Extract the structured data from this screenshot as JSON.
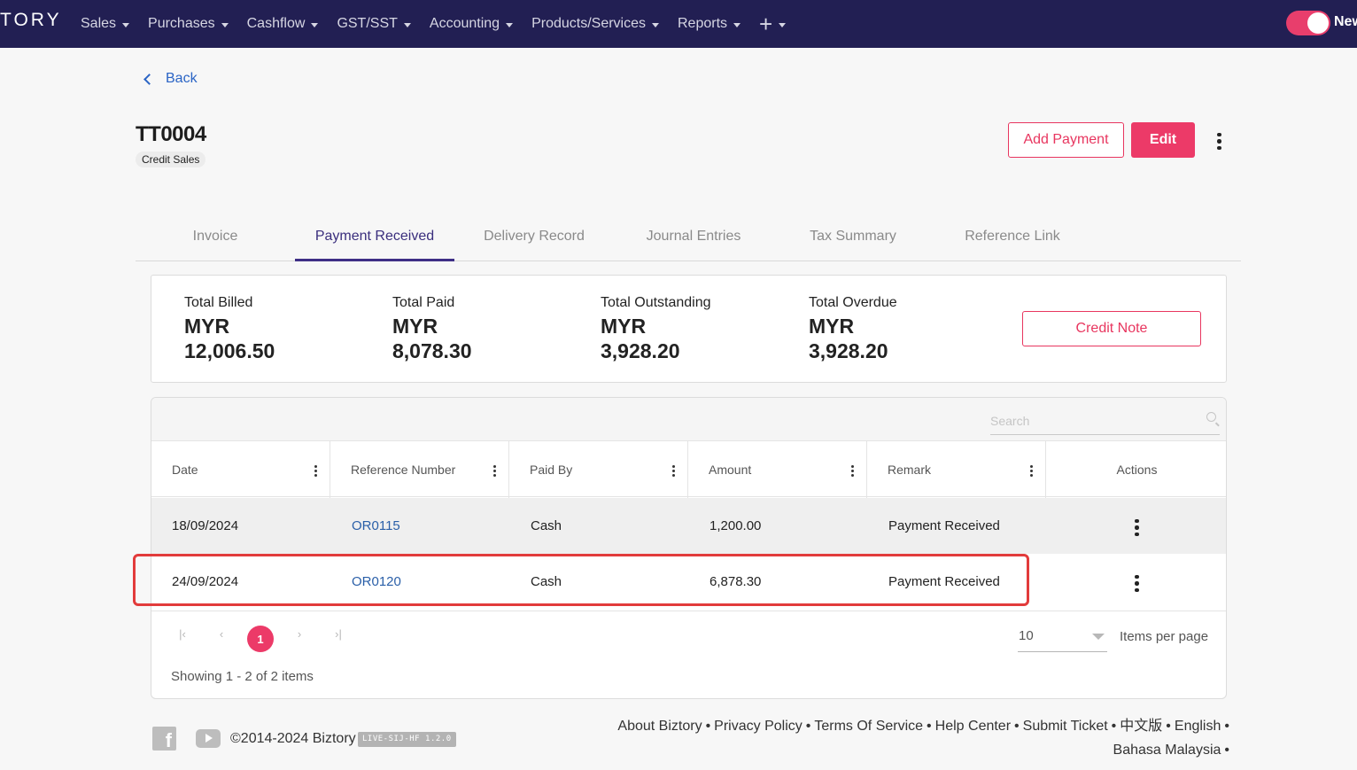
{
  "nav": {
    "logo": "TORY",
    "items": [
      {
        "label": "Sales"
      },
      {
        "label": "Purchases"
      },
      {
        "label": "Cashflow"
      },
      {
        "label": "GST/SST"
      },
      {
        "label": "Accounting"
      },
      {
        "label": "Products/Services"
      },
      {
        "label": "Reports"
      }
    ],
    "plus_label": "+",
    "toggle_label": "New"
  },
  "header": {
    "back_label": "Back",
    "title": "TT0004",
    "badge": "Credit Sales",
    "add_payment_label": "Add Payment",
    "edit_label": "Edit"
  },
  "tabs": [
    {
      "label": "Invoice",
      "active": false
    },
    {
      "label": "Payment Received",
      "active": true
    },
    {
      "label": "Delivery Record",
      "active": false
    },
    {
      "label": "Journal Entries",
      "active": false
    },
    {
      "label": "Tax Summary",
      "active": false
    },
    {
      "label": "Reference Link",
      "active": false
    }
  ],
  "summary": {
    "stats": [
      {
        "label": "Total Billed",
        "currency": "MYR",
        "amount": "12,006.50"
      },
      {
        "label": "Total Paid",
        "currency": "MYR",
        "amount": "8,078.30"
      },
      {
        "label": "Total Outstanding",
        "currency": "MYR",
        "amount": "3,928.20"
      },
      {
        "label": "Total Overdue",
        "currency": "MYR",
        "amount": "3,928.20"
      }
    ],
    "credit_note_label": "Credit Note"
  },
  "table": {
    "search_placeholder": "Search",
    "columns": [
      "Date",
      "Reference Number",
      "Paid By",
      "Amount",
      "Remark",
      "Actions"
    ],
    "rows": [
      {
        "date": "18/09/2024",
        "reference": "OR0115",
        "paid_by": "Cash",
        "amount": "1,200.00",
        "remark": "Payment Received"
      },
      {
        "date": "24/09/2024",
        "reference": "OR0120",
        "paid_by": "Cash",
        "amount": "6,878.30",
        "remark": "Payment Received"
      }
    ],
    "pagination": {
      "first": "|‹",
      "prev": "‹",
      "current_page": "1",
      "next": "›",
      "last": "›|",
      "items_per_page_value": "10",
      "items_per_page_label": "Items per page",
      "showing": "Showing 1 - 2 of 2 items"
    }
  },
  "footer": {
    "copyright": "©2014-2024 Biztory",
    "version": "LIVE-SIJ-HF 1.2.0",
    "links": [
      "About Biztory",
      "Privacy Policy",
      "Terms Of Service",
      "Help Center",
      "Submit Ticket",
      "中文版",
      "English",
      "Bahasa Malaysia"
    ]
  },
  "colors": {
    "nav_bg": "#221f53",
    "accent": "#ec3a68",
    "link": "#2a5fa8",
    "tab_active": "#3e2f86",
    "highlight": "#e23b3b"
  }
}
